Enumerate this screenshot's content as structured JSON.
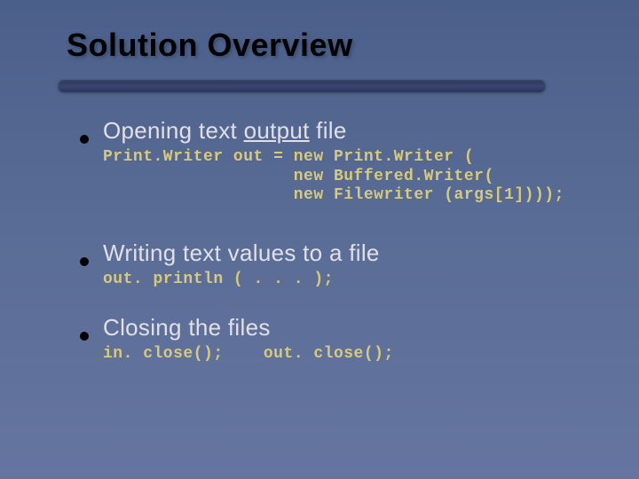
{
  "title": "Solution Overview",
  "bullets": [
    {
      "text_pre": "Opening text ",
      "text_underlined": "output",
      "text_post": " file",
      "code": "Print.Writer out = new Print.Writer (\n                   new Buffered.Writer(\n                   new Filewriter (args[1])));"
    },
    {
      "text_pre": "Writing text values to a file",
      "text_underlined": "",
      "text_post": "",
      "code": "out. println ( . . . );"
    },
    {
      "text_pre": "Closing the files",
      "text_underlined": "",
      "text_post": "",
      "code": "in. close();    out. close();"
    }
  ]
}
